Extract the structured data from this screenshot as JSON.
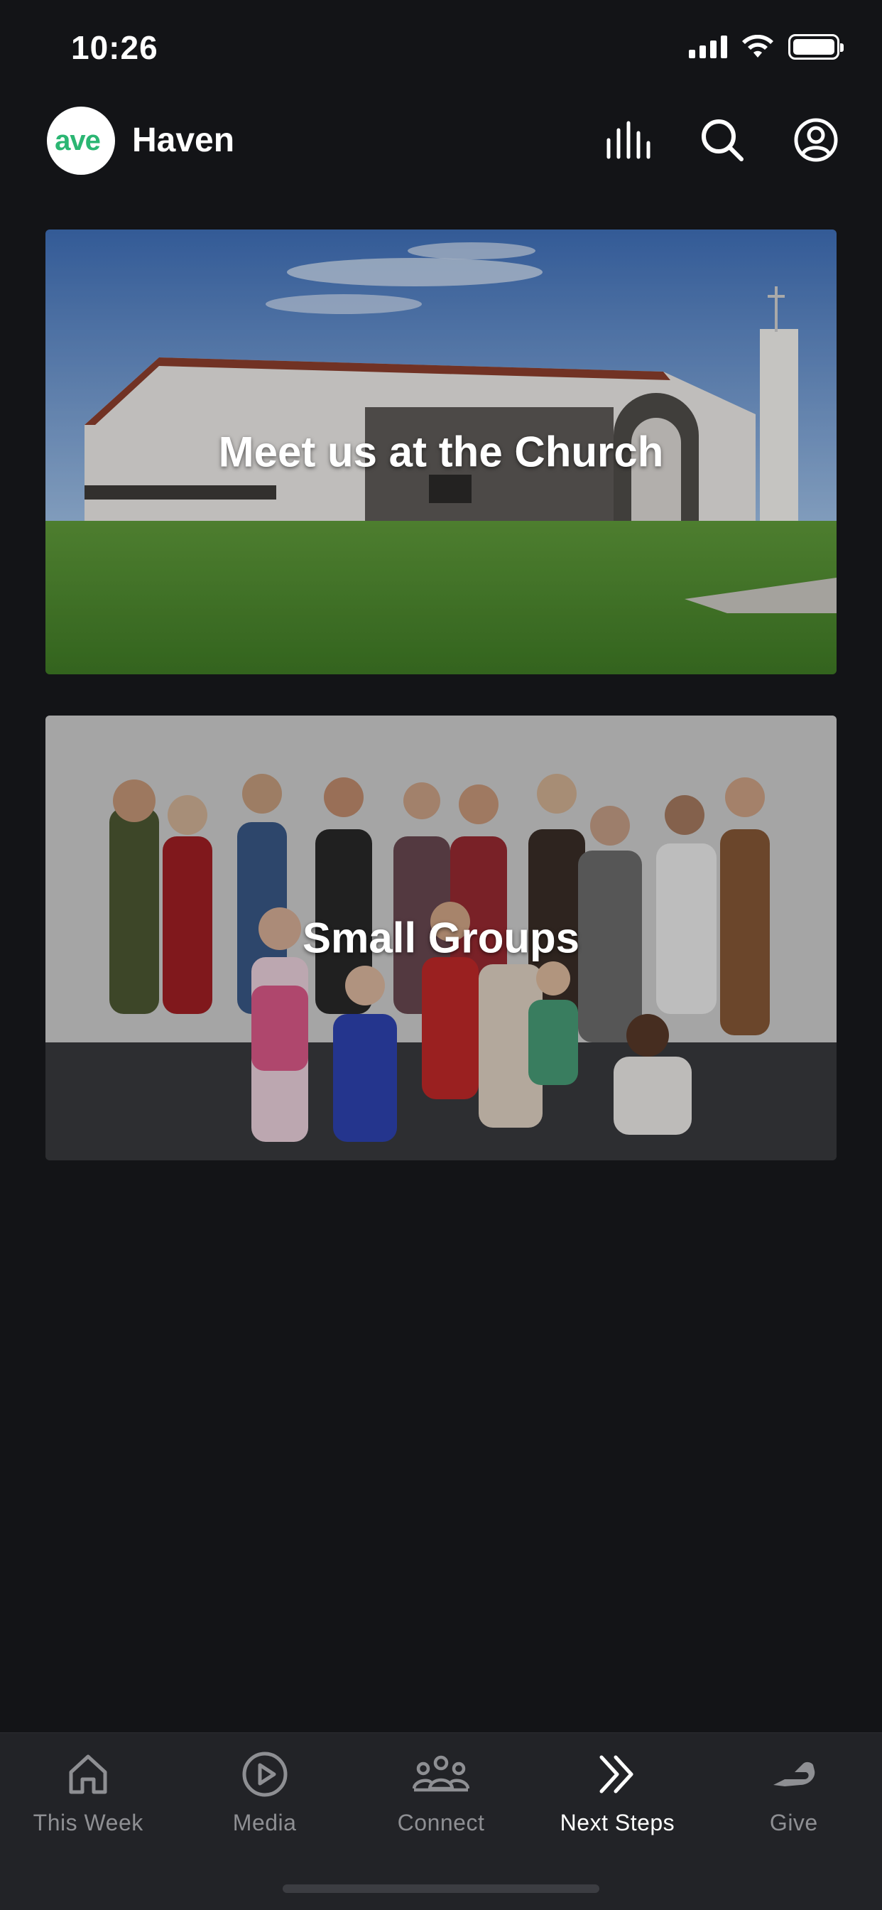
{
  "status_bar": {
    "time": "10:26"
  },
  "header": {
    "logo_text": "ave",
    "title": "Haven"
  },
  "cards": [
    {
      "title": "Meet us at the Church"
    },
    {
      "title": "Small Groups"
    }
  ],
  "tab_bar": {
    "tabs": [
      {
        "label": "This Week",
        "icon": "home-icon",
        "active": false
      },
      {
        "label": "Media",
        "icon": "play-circle-icon",
        "active": false
      },
      {
        "label": "Connect",
        "icon": "people-icon",
        "active": false
      },
      {
        "label": "Next Steps",
        "icon": "double-chevron-right-icon",
        "active": true
      },
      {
        "label": "Give",
        "icon": "hand-icon",
        "active": false
      }
    ]
  },
  "colors": {
    "background": "#131417",
    "tab_bar": "#222327",
    "inactive_label": "#8e8f93",
    "accent_logo": "#2bb673"
  }
}
